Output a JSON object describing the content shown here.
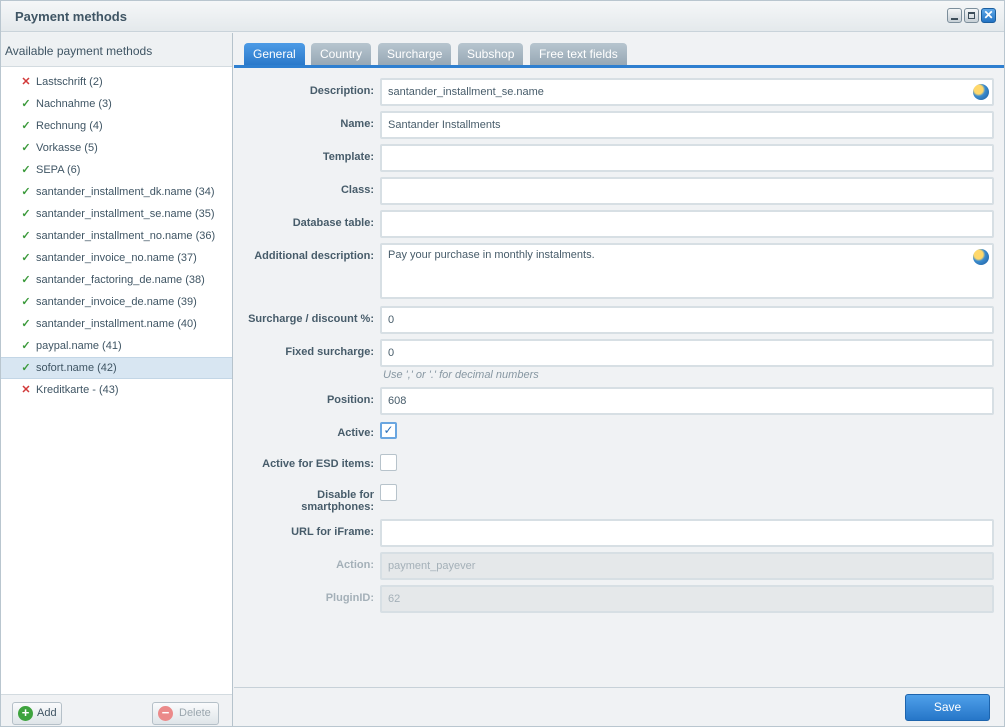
{
  "window": {
    "title": "Payment methods"
  },
  "sidebar": {
    "header": "Available payment methods",
    "items": [
      {
        "label": "Lastschrift (2)",
        "active": false
      },
      {
        "label": "Nachnahme (3)",
        "active": true
      },
      {
        "label": "Rechnung (4)",
        "active": true
      },
      {
        "label": "Vorkasse (5)",
        "active": true
      },
      {
        "label": "SEPA (6)",
        "active": true
      },
      {
        "label": "santander_installment_dk.name (34)",
        "active": true
      },
      {
        "label": "santander_installment_se.name (35)",
        "active": true
      },
      {
        "label": "santander_installment_no.name (36)",
        "active": true
      },
      {
        "label": "santander_invoice_no.name (37)",
        "active": true
      },
      {
        "label": "santander_factoring_de.name (38)",
        "active": true
      },
      {
        "label": "santander_invoice_de.name (39)",
        "active": true
      },
      {
        "label": "santander_installment.name (40)",
        "active": true
      },
      {
        "label": "paypal.name (41)",
        "active": true
      },
      {
        "label": "sofort.name (42)",
        "active": true,
        "selected": true
      },
      {
        "label": "Kreditkarte - (43)",
        "active": false
      }
    ],
    "add_label": "Add",
    "delete_label": "Delete"
  },
  "tabs": [
    {
      "label": "General",
      "active": true
    },
    {
      "label": "Country"
    },
    {
      "label": "Surcharge"
    },
    {
      "label": "Subshop"
    },
    {
      "label": "Free text fields"
    }
  ],
  "form": {
    "description": {
      "label": "Description:",
      "value": "santander_installment_se.name"
    },
    "name": {
      "label": "Name:",
      "value": "Santander Installments"
    },
    "template": {
      "label": "Template:",
      "value": ""
    },
    "class": {
      "label": "Class:",
      "value": ""
    },
    "database_table": {
      "label": "Database table:",
      "value": ""
    },
    "additional_description": {
      "label": "Additional description:",
      "value": "Pay your purchase in monthly instalments."
    },
    "surcharge_discount": {
      "label": "Surcharge / discount %:",
      "value": "0"
    },
    "fixed_surcharge": {
      "label": "Fixed surcharge:",
      "value": "0",
      "hint": "Use ',' or '.' for decimal numbers"
    },
    "position": {
      "label": "Position:",
      "value": "608"
    },
    "active": {
      "label": "Active:",
      "checked": true
    },
    "active_esd": {
      "label": "Active for ESD items:",
      "checked": false
    },
    "disable_smartphones": {
      "label_line1": "Disable for",
      "label_line2": "smartphones:",
      "checked": false
    },
    "url_iframe": {
      "label": "URL for iFrame:",
      "value": ""
    },
    "action": {
      "label": "Action:",
      "value": "payment_payever"
    },
    "plugin_id": {
      "label": "PluginID:",
      "value": "62"
    }
  },
  "footer": {
    "save_label": "Save"
  },
  "icons": {
    "ok": "check-icon",
    "inactive": "cross-icon",
    "translate": "globe-icon"
  },
  "colors": {
    "accent": "#2a79ca",
    "ok": "#3c9a3c",
    "inactive": "#d23a3a"
  }
}
